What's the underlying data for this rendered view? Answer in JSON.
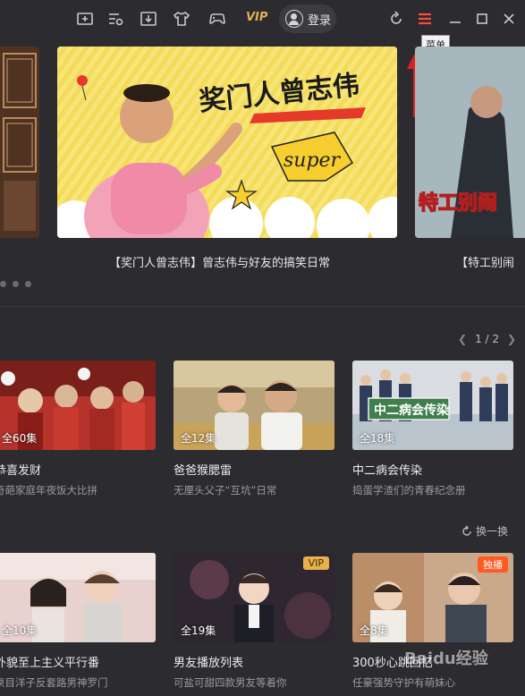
{
  "topbar": {
    "vip_label": "VIP",
    "login_label": "登录",
    "tooltip": "菜单",
    "icons": [
      "video-add-icon",
      "playlist-icon",
      "download-icon",
      "skin-icon",
      "game-icon",
      "refresh-icon",
      "menu-icon",
      "minimize-icon",
      "maximize-icon",
      "close-icon"
    ],
    "menu_color": "#ff4a3d"
  },
  "banner": {
    "poster_title": "奖门人曾志伟",
    "poster_badge": "super",
    "right_poster_text": "特工别闹",
    "captions": [
      "【奖门人曾志伟】曾志伟与好友的搞笑日常",
      "【特工别闹"
    ]
  },
  "pager": {
    "label": "1 / 2"
  },
  "row1": [
    {
      "ep": "全60集",
      "title": "恭喜发财",
      "sub": "奇葩家庭年夜饭大比拼"
    },
    {
      "ep": "全12集",
      "title": "爸爸猴腮雷",
      "sub": "无厘头父子“互坑”日常"
    },
    {
      "ep": "全18集",
      "title": "中二病会传染",
      "sub": "捣蛋学渣们的青春纪念册",
      "poster_text": "中二病会传染"
    }
  ],
  "refresh_label": "换一换",
  "row2": [
    {
      "ep": "全10集",
      "title": "外貌至上主义平行番",
      "sub": "柬目洋子反套路男神罗门"
    },
    {
      "ep": "全19集",
      "title": "男友播放列表",
      "sub": "可盐可甜四款男友等着你",
      "tag": "VIP",
      "tag_color": "#e8b24a"
    },
    {
      "ep": "全8集",
      "title": "300秒心跳回忆",
      "sub": "任豪强势守护有萌妹心",
      "tag": "独播",
      "tag_color": "#ff5a1f"
    }
  ],
  "watermark": "Baidu经验"
}
